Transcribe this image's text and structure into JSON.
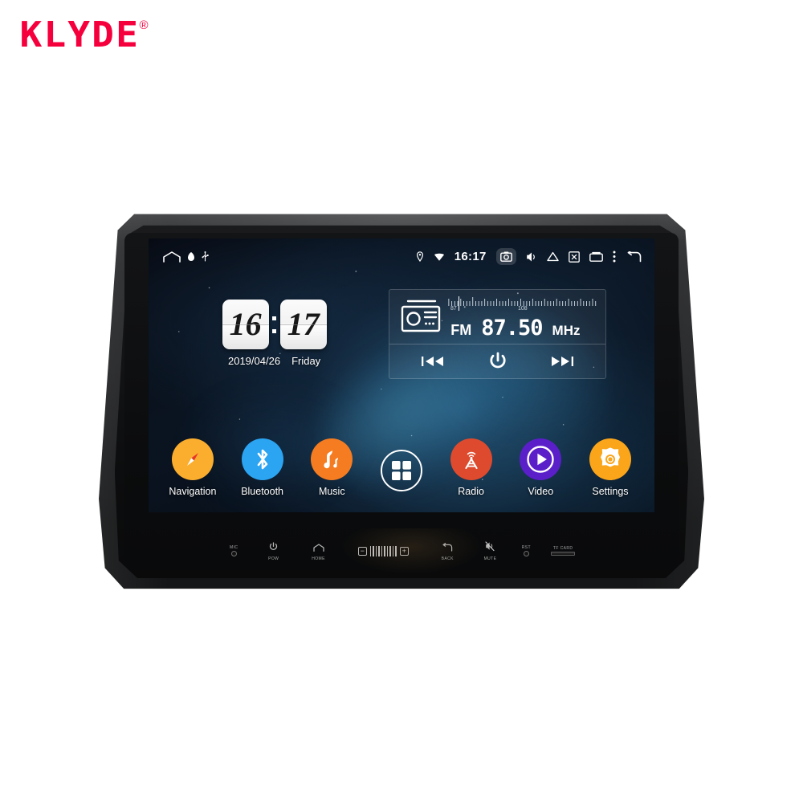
{
  "brand": {
    "name": "KLYDE",
    "trademark": "®",
    "color": "#f5003c"
  },
  "device": {
    "type": "car-head-unit"
  },
  "statusbar": {
    "left_icons": [
      {
        "name": "home-icon",
        "glyph": "home"
      },
      {
        "name": "bluetooth-dot-icon",
        "glyph": "dot"
      },
      {
        "name": "usb-icon",
        "glyph": "usb"
      }
    ],
    "right_icons": [
      {
        "name": "location-pin-icon",
        "glyph": "pin"
      },
      {
        "name": "wifi-icon",
        "glyph": "wifi"
      }
    ],
    "time": "16:17",
    "trailing_icons": [
      {
        "name": "camera-icon",
        "glyph": "camera",
        "highlighted": true
      },
      {
        "name": "volume-icon",
        "glyph": "speaker"
      },
      {
        "name": "eject-icon",
        "glyph": "eject"
      },
      {
        "name": "screenshot-icon",
        "glyph": "x-box"
      },
      {
        "name": "recents-icon",
        "glyph": "recents"
      },
      {
        "name": "overflow-menu-icon",
        "glyph": "dots"
      },
      {
        "name": "back-icon",
        "glyph": "back-arrow"
      }
    ]
  },
  "clock": {
    "hours": "16",
    "minutes": "17",
    "date": "2019/04/26",
    "weekday": "Friday"
  },
  "radio": {
    "band": "FM",
    "frequency": "87.50",
    "unit": "MHz",
    "scale_min": "87",
    "scale_max": "108",
    "controls": [
      {
        "name": "prev-station-button",
        "label": "prev"
      },
      {
        "name": "radio-power-button",
        "label": "power"
      },
      {
        "name": "next-station-button",
        "label": "next"
      }
    ]
  },
  "dock": {
    "apps": [
      {
        "label": "Navigation",
        "icon": "compass-icon",
        "color": "#fbae2e"
      },
      {
        "label": "Bluetooth",
        "icon": "bluetooth-icon",
        "color": "#2ba4f2"
      },
      {
        "label": "Music",
        "icon": "music-note-icon",
        "color": "#f57c20"
      },
      {
        "label": "",
        "icon": "app-drawer-icon",
        "color": "transparent"
      },
      {
        "label": "Radio",
        "icon": "radio-tower-icon",
        "color": "#de4a2d"
      },
      {
        "label": "Video",
        "icon": "video-play-icon",
        "color": "#5a1fc8"
      },
      {
        "label": "Settings",
        "icon": "gear-icon",
        "color": "#faa51a"
      }
    ]
  },
  "hardware_buttons": [
    {
      "label": "MIC",
      "icon": "mic-hole-icon",
      "label_position": "above"
    },
    {
      "label": "POW",
      "icon": "power-icon",
      "label_position": "below"
    },
    {
      "label": "HOME",
      "icon": "home-outline-icon",
      "label_position": "below"
    },
    {
      "label": "BACK",
      "icon": "back-arrow-icon",
      "label_position": "below"
    },
    {
      "label": "MUTE",
      "icon": "mute-speaker-icon",
      "label_position": "below"
    },
    {
      "label": "RST",
      "icon": "reset-hole-icon",
      "label_position": "above"
    }
  ],
  "volume_control": {
    "minus": "−",
    "plus": "+",
    "name": "volume-rocker"
  },
  "card_slot": {
    "label": "TF CARD"
  }
}
